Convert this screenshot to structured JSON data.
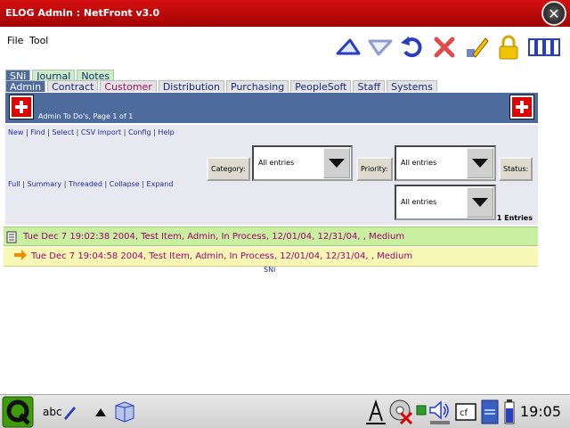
{
  "window": {
    "title": "ELOG Admin : NetFront v3.0"
  },
  "menu": [
    {
      "label": "File"
    },
    {
      "label": "Tool"
    }
  ],
  "toolbar": {
    "icons": [
      "back-icon",
      "forward-icon",
      "refresh-icon",
      "stop-icon",
      "edit-icon",
      "lock-icon",
      "bookmarks-icon"
    ]
  },
  "tabs_row1": [
    {
      "label": "SNi"
    },
    {
      "label": "Journal"
    },
    {
      "label": "Notes"
    }
  ],
  "tabs_row2": [
    {
      "label": "Admin"
    },
    {
      "label": "Contract"
    },
    {
      "label": "Customer"
    },
    {
      "label": "Distribution"
    },
    {
      "label": "Purchasing"
    },
    {
      "label": "PeopleSoft"
    },
    {
      "label": "Staff"
    },
    {
      "label": "Systems"
    }
  ],
  "header": {
    "caption": "Admin To Do's, Page 1 of 1"
  },
  "commands": [
    {
      "label": "New"
    },
    {
      "label": "Find"
    },
    {
      "label": "Select"
    },
    {
      "label": "CSV Import"
    },
    {
      "label": "Config"
    },
    {
      "label": "Help"
    }
  ],
  "views": [
    {
      "label": "Full"
    },
    {
      "label": "Summary"
    },
    {
      "label": "Threaded"
    },
    {
      "label": "Collapse"
    },
    {
      "label": "Expand"
    }
  ],
  "filters": {
    "category": {
      "label": "Category:",
      "value": "All entries"
    },
    "priority": {
      "label": "Priority:",
      "value": "All entries"
    },
    "status": {
      "label": "Status:",
      "value": "All entries"
    },
    "count": "1 Entries"
  },
  "entries": [
    {
      "text": "Tue Dec 7 19:02:38 2004, Test Item, Admin, In Process, 12/01/04, 12/31/04, , Medium"
    },
    {
      "text": "Tue Dec 7 19:04:58 2004, Test Item, Admin, In Process, 12/01/04, 12/31/04, , Medium"
    }
  ],
  "footer": {
    "label": "SNi"
  },
  "taskbar": {
    "input_label": "abc",
    "clock": "19:05"
  },
  "colors": {
    "titlebar": "#c00808",
    "header": "#4e6b9e",
    "entry_green": "#c9f0a0",
    "entry_yellow": "#f6f8b4",
    "entry_text": "#a00074",
    "link": "#1c2ba3"
  }
}
